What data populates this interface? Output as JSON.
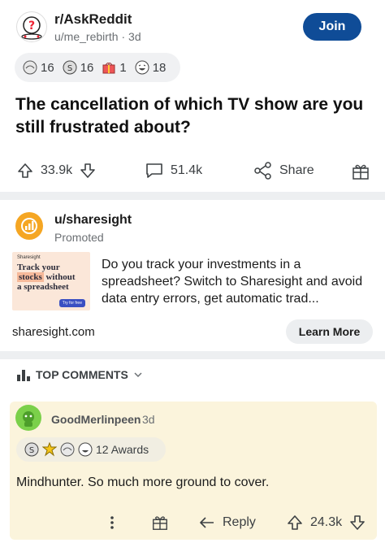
{
  "post": {
    "subreddit": "r/AskReddit",
    "author": "u/me_rebirth",
    "separator": "·",
    "age": "3d",
    "join_label": "Join",
    "awards": [
      {
        "icon": "hands-award-icon",
        "count": "16"
      },
      {
        "icon": "silver-coin-award-icon",
        "count": "16"
      },
      {
        "icon": "gift-award-icon",
        "count": "1"
      },
      {
        "icon": "laughing-award-icon",
        "count": "18"
      }
    ],
    "title": "The cancellation of which TV show are you still frustrated about?",
    "upvotes": "33.9k",
    "comments": "51.4k",
    "share_label": "Share"
  },
  "ad": {
    "user": "u/sharesight",
    "promoted_label": "Promoted",
    "image": {
      "brand": "Sharesight",
      "line1": "Track your",
      "line2a": "stocks",
      "line2b": " without",
      "line3": "a spreadsheet",
      "cta": "Try for free"
    },
    "text": "Do you track your investments in a spreadsheet? Switch to Sharesight and avoid data entry errors, get automatic trad...",
    "domain": "sharesight.com",
    "cta_label": "Learn More"
  },
  "sort": {
    "label": "TOP COMMENTS"
  },
  "comment": {
    "user": "GoodMerlinpeen",
    "age": "3d",
    "awards_label": "12 Awards",
    "body": "Mindhunter. So much more ground to cover.",
    "reply_label": "Reply",
    "score": "24.3k"
  },
  "colors": {
    "join_bg": "#0f4c97",
    "comment_bg": "#fbf4dc",
    "divider": "#edeff1"
  }
}
